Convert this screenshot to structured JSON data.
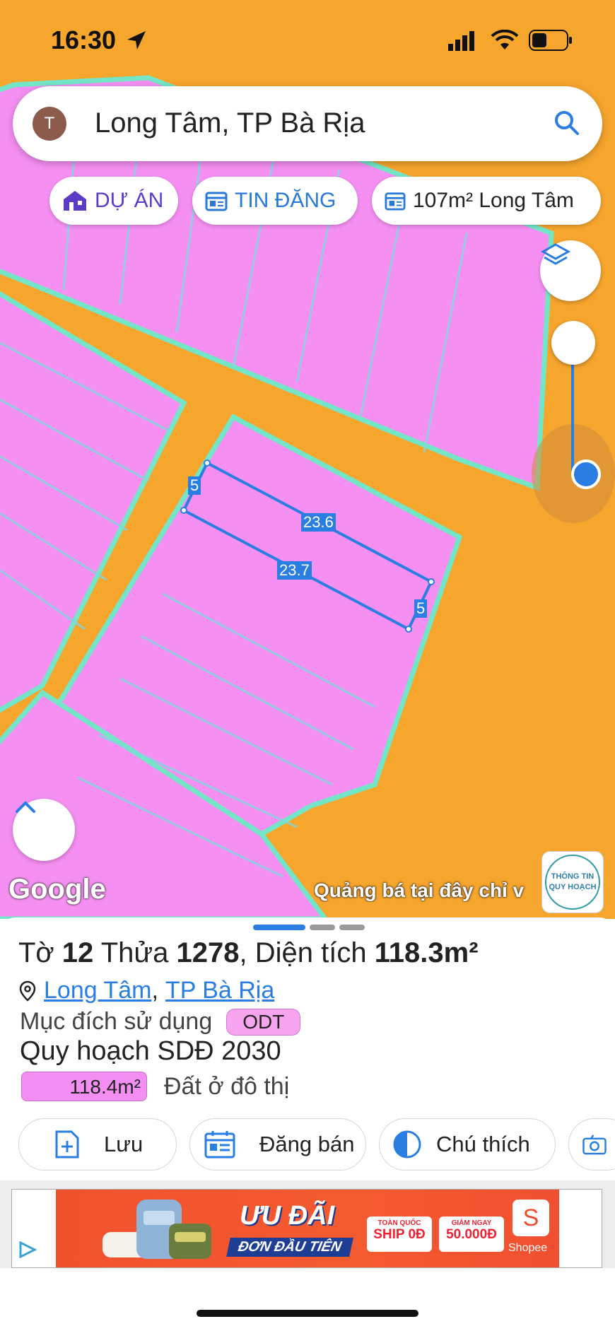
{
  "status_bar": {
    "time": "16:30"
  },
  "search": {
    "avatar_letter": "T",
    "query": "Long Tâm, TP Bà Rịa"
  },
  "chips": [
    {
      "label": "DỰ ÁN",
      "icon": "house-icon"
    },
    {
      "label": "TIN ĐĂNG",
      "icon": "listing-icon"
    },
    {
      "label": "107m² Long Tâm",
      "icon": "listing-icon"
    }
  ],
  "map": {
    "dimensions": {
      "top": "5",
      "long_top": "23.6",
      "long_bottom": "23.7",
      "right": "5"
    },
    "google_label": "Google",
    "ad_overlay": "Quảng bá tại đây chỉ v",
    "badge": {
      "line1": "THÔNG TIN",
      "line2": "QUY HOẠCH"
    },
    "colors": {
      "road": "#f6a52d",
      "parcel": "#f58ff2",
      "boundary": "#74e6c8",
      "measure": "#2a7de1"
    }
  },
  "parcel": {
    "sheet_label": "Tờ",
    "sheet_no": "12",
    "lot_label": "Thửa",
    "lot_no": "1278",
    "area_label": "Diện tích",
    "area": "118.3m²",
    "ward": "Long Tâm",
    "city": "TP Bà Rịa",
    "purpose_label": "Mục đích sử dụng",
    "purpose_code": "ODT",
    "plan_label": "Quy hoạch SDĐ 2030",
    "plan_area": "118.4m²",
    "plan_type": "Đất ở đô thị"
  },
  "actions": [
    {
      "label": "Lưu",
      "icon": "save-file-icon"
    },
    {
      "label": "Đăng bán",
      "icon": "calendar-icon"
    },
    {
      "label": "Chú thích",
      "icon": "legend-icon"
    },
    {
      "label": "",
      "icon": "camera-icon"
    }
  ],
  "ad": {
    "headline": "ƯU ĐÃI",
    "sub": "ĐƠN ĐẦU TIÊN",
    "box1_small": "TOÀN QUỐC",
    "box1_big": "SHIP 0Đ",
    "box2_small": "GIẢM NGAY",
    "box2_big": "50.000Đ",
    "brand": "Shopee"
  }
}
